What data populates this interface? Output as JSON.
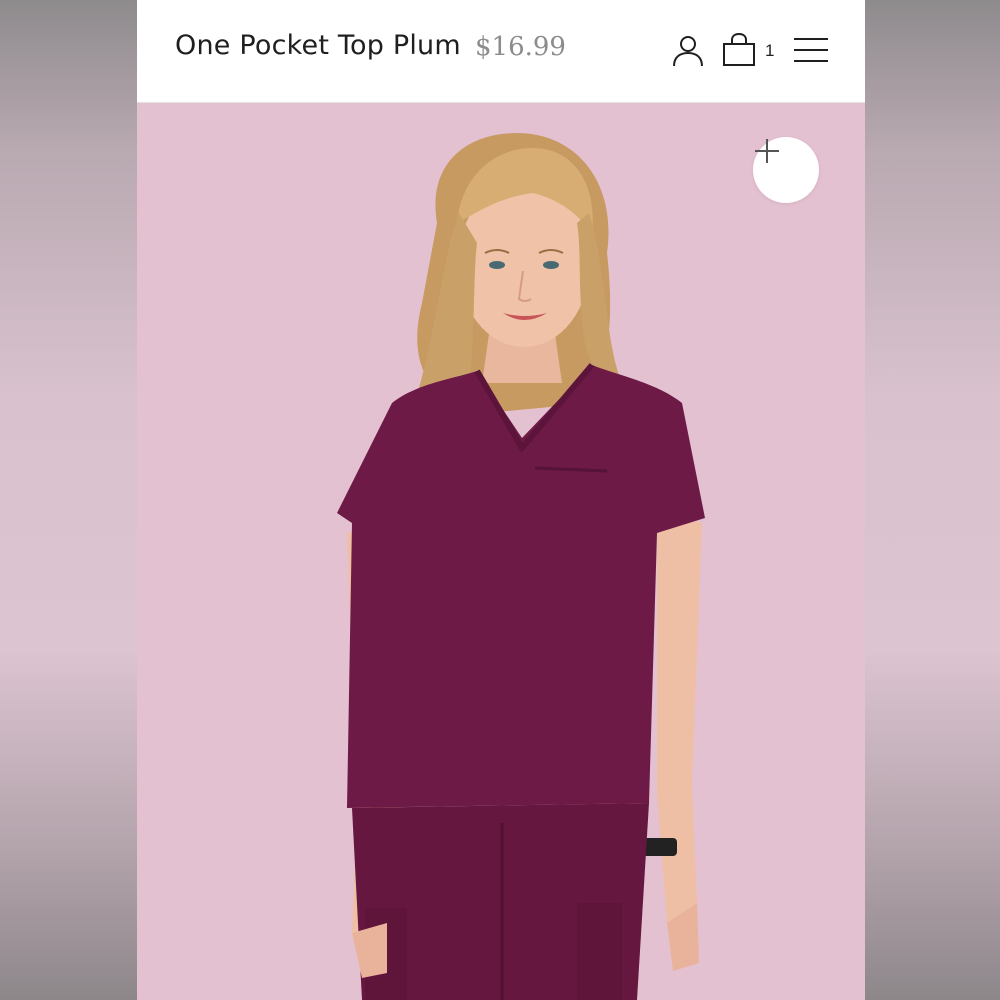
{
  "header": {
    "product_title": "One Pocket Top Plum",
    "price": "$16.99",
    "cart_count": "1",
    "icons": [
      "account-icon",
      "shopping-bag-icon",
      "hamburger-menu-icon"
    ]
  },
  "hero": {
    "image_icon": "plus-icon",
    "colors": {
      "background": "#e4c1d1",
      "garment": "#6d1a47"
    }
  }
}
